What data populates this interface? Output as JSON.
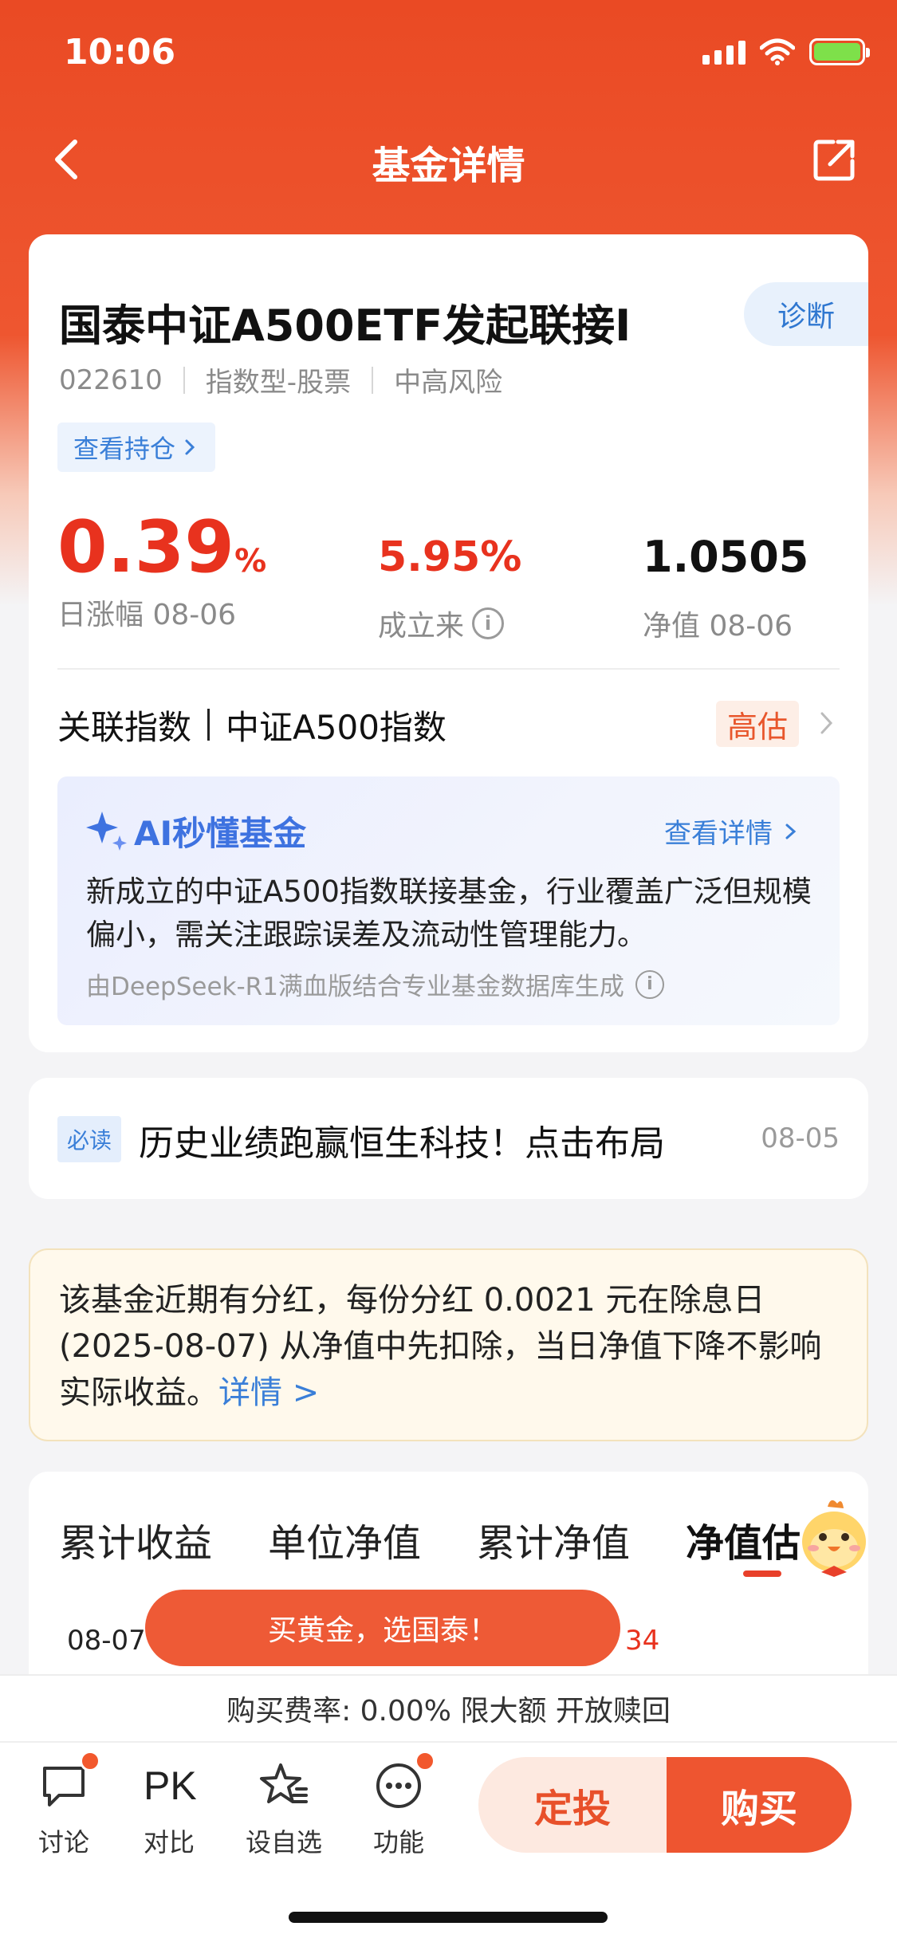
{
  "status_bar": {
    "time": "10:06"
  },
  "nav": {
    "title": "基金详情"
  },
  "fund": {
    "name": "国泰中证A500ETF发起联接I",
    "diagnose_label": "诊断",
    "code": "022610",
    "type": "指数型-股票",
    "risk": "中高风险",
    "holdings_label": "查看持仓",
    "daily_change_value": "0.39",
    "daily_change_unit": "%",
    "daily_change_label": "日涨幅 08-06",
    "since_inception_value": "5.95%",
    "since_inception_label": "成立来",
    "nav_value": "1.0505",
    "nav_label": "净值 08-06",
    "index_label": "关联指数",
    "index_name": "中证A500指数",
    "valuation_badge": "高估"
  },
  "ai": {
    "title": "AI秒懂基金",
    "more_label": "查看详情",
    "summary": "新成立的中证A500指数联接基金，行业覆盖广泛但规模偏小，需关注跟踪误差及流动性管理能力。",
    "footnote": "由DeepSeek-R1满血版结合专业基金数据库生成"
  },
  "news": {
    "badge": "必读",
    "title": "历史业绩跑赢恒生科技！点击布局",
    "date": "08-05"
  },
  "notice": {
    "text": "该基金近期有分红，每份分红 0.0021 元在除息日 (2025-08-07) 从净值中先扣除，当日净值下降不影响实际收益。",
    "link_label": "详情 >"
  },
  "chart_tabs": {
    "tabs": [
      "累计收益",
      "单位净值",
      "累计净值",
      "净值估"
    ],
    "active_index": 3,
    "row_date": "08-07",
    "row_value": "34"
  },
  "promo": {
    "label": "买黄金，选国泰！"
  },
  "fee": {
    "text": "购买费率: 0.00% 限大额 开放赎回"
  },
  "bottom": {
    "discuss_label": "讨论",
    "pk_icon_text": "PK",
    "compare_label": "对比",
    "watchlist_label": "设自选",
    "function_label": "功能",
    "dingtou_label": "定投",
    "buy_label": "购买"
  },
  "colors": {
    "brand": "#ea4a24",
    "rise": "#e8321e",
    "link": "#3a7fd8",
    "buy_button": "#ee5530"
  }
}
